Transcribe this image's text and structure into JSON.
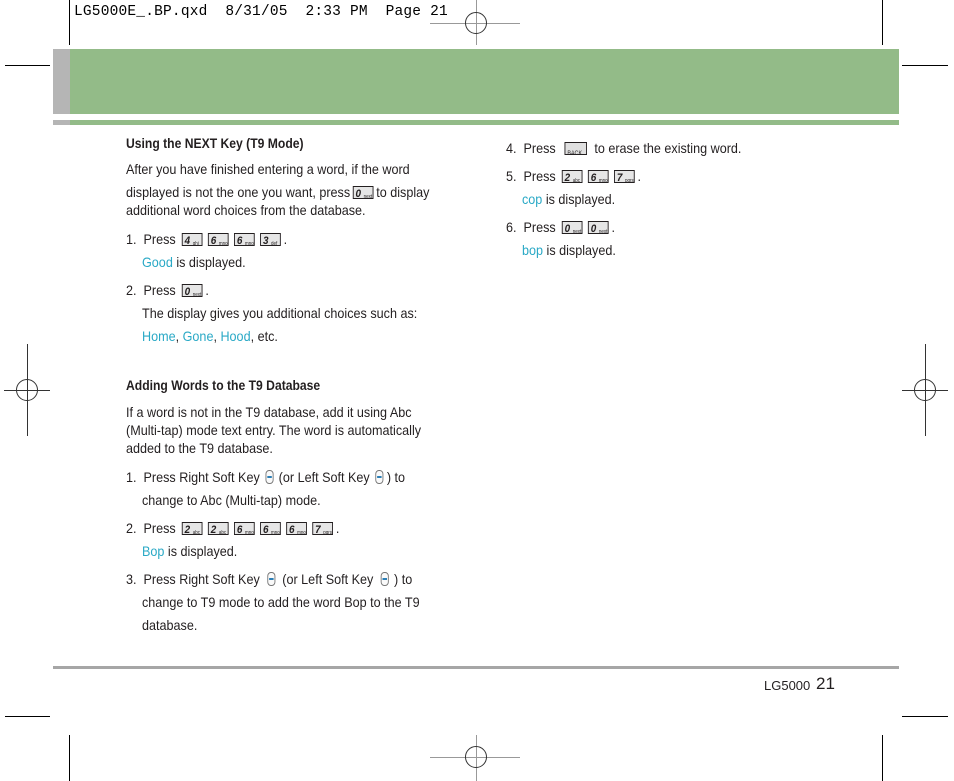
{
  "slug": {
    "filename": "LG5000E_.BP.qxd",
    "date": "8/31/05",
    "time": "2:33 PM",
    "page_label": "Page 21"
  },
  "colors": {
    "banner_green": "#93bb88",
    "banner_gray": "#b5b5b5",
    "highlight": "#2aa9c6",
    "rule": "#a6a6a6"
  },
  "left": {
    "section1": {
      "heading": "Using the NEXT Key (T9 Mode)",
      "intro_line1": "After you have finished entering a word, if the word",
      "intro_line2_pre": "displayed is not the one you want, press",
      "intro_line2_post": "to display",
      "intro_line3": "additional word choices from the database.",
      "intro_key": {
        "digit": "0",
        "letters": "next"
      },
      "steps": [
        {
          "num": "1.",
          "text": "Press",
          "keys": [
            {
              "digit": "4",
              "letters": "ghi"
            },
            {
              "digit": "6",
              "letters": "mno"
            },
            {
              "digit": "6",
              "letters": "mno"
            },
            {
              "digit": "3",
              "letters": "def"
            }
          ],
          "end": ".",
          "result_word": "Good",
          "result_text": " is displayed."
        },
        {
          "num": "2.",
          "text": "Press",
          "keys": [
            {
              "digit": "0",
              "letters": "next"
            }
          ],
          "end": ".",
          "line2": "The display gives you additional choices such as:",
          "choices": [
            "Home",
            "Gone",
            "Hood"
          ],
          "sep": ", ",
          "suffix": ", etc."
        }
      ]
    },
    "section2": {
      "heading": "Adding Words to the T9 Database",
      "intro_line1": "If a word is not in the T9 database, add it using Abc",
      "intro_line2": "(Multi-tap) mode text entry. The word is automatically",
      "intro_line3": "added to the T9 database.",
      "steps": [
        {
          "num": "1.",
          "text_a": "Press Right Soft Key",
          "text_b": "(or Left Soft Key",
          "text_c": ") to",
          "line2": "change to Abc (Multi-tap) mode.",
          "icon": "soft-key-icon"
        },
        {
          "num": "2.",
          "text": "Press",
          "keys": [
            {
              "digit": "2",
              "letters": "abc"
            },
            {
              "digit": "2",
              "letters": "abc"
            },
            {
              "digit": "6",
              "letters": "mno"
            },
            {
              "digit": "6",
              "letters": "mno"
            },
            {
              "digit": "6",
              "letters": "mno"
            },
            {
              "digit": "7",
              "letters": "pqrs"
            }
          ],
          "end": ".",
          "result_word": "Bop",
          "result_text": " is displayed."
        },
        {
          "num": "3.",
          "text_a": "Press Right Soft Key",
          "text_b": "(or Left Soft Key",
          "text_c": ") to",
          "line2": "change to T9 mode to add the word Bop to the T9",
          "line3": "database.",
          "icon": "soft-key-icon"
        }
      ]
    }
  },
  "right": {
    "steps": [
      {
        "num": "4.",
        "text": "Press",
        "keys": [
          {
            "label": "BACK"
          }
        ],
        "after": "to erase the existing word."
      },
      {
        "num": "5.",
        "text": "Press",
        "keys": [
          {
            "digit": "2",
            "letters": "abc"
          },
          {
            "digit": "6",
            "letters": "mno"
          },
          {
            "digit": "7",
            "letters": "pqrs"
          }
        ],
        "end": ".",
        "result_word": "cop",
        "result_text": " is displayed."
      },
      {
        "num": "6.",
        "text": "Press",
        "keys": [
          {
            "digit": "0",
            "letters": "next"
          },
          {
            "digit": "0",
            "letters": "next"
          }
        ],
        "end": ".",
        "result_word": "bop",
        "result_text": " is displayed."
      }
    ]
  },
  "footer": {
    "model": "LG5000",
    "page_number": "21"
  }
}
